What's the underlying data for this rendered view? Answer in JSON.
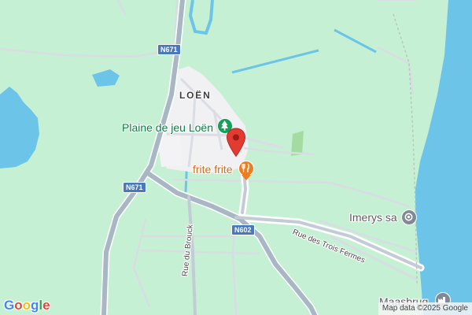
{
  "map": {
    "place_label": "LOËN",
    "pois": {
      "playground": "Plaine de jeu Loën",
      "restaurant": "frite frite",
      "company": "Imerys sa",
      "bottom_partial": "Maasbrug"
    },
    "streets": {
      "rue_du_brouck": "Rue du Brouck",
      "rue_des_trois_fermes": "Rue des Trois Fermes"
    },
    "road_shields": {
      "n671_top": "N671",
      "n671_left": "N671",
      "n602": "N602"
    },
    "icons": {
      "playground": "tree-icon",
      "restaurant": "fork-knife-icon",
      "company": "location-dot-icon",
      "bottom": "factory-icon",
      "pin": "map-pin-icon"
    },
    "colors": {
      "background": "#c6f0d4",
      "water": "#6cc5e8",
      "built_area": "#f1f0f3",
      "road": "#a9b6c4",
      "pin": "#e23c32",
      "poi_green": "#12a05a",
      "poi_orange": "#ee7d1f",
      "poi_gray": "#7f8a94"
    }
  },
  "branding": {
    "logo": "Google"
  },
  "attribution": {
    "text": "Map data ©2025 Google"
  }
}
